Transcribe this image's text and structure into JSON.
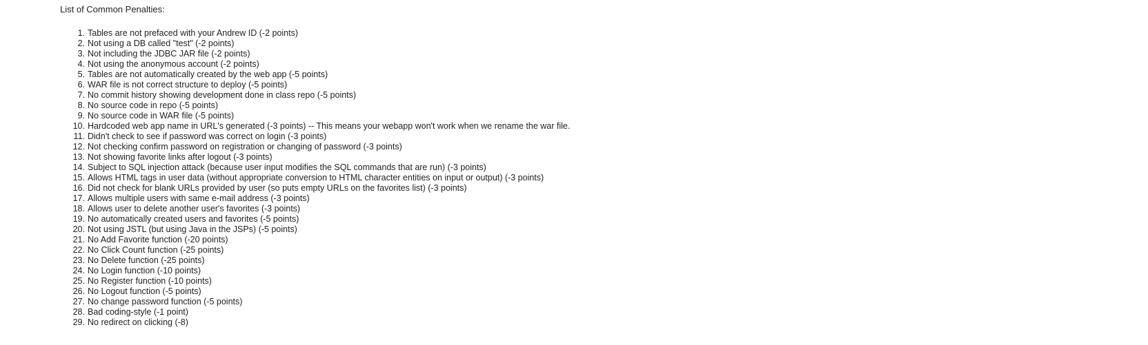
{
  "heading": "List of Common Penalties:",
  "items": [
    {
      "num": "1.",
      "text": "Tables are not prefaced with your Andrew ID (-2 points)"
    },
    {
      "num": "2.",
      "text": "Not using a DB called \"test\" (-2 points)"
    },
    {
      "num": "3.",
      "text": "Not including the JDBC JAR file (-2 points)"
    },
    {
      "num": "4.",
      "text": "Not using the anonymous account (-2 points)"
    },
    {
      "num": "5.",
      "text": "Tables are not automatically created by the web app (-5 points)"
    },
    {
      "num": "6.",
      "text": "WAR file is not correct structure to deploy (-5 points)"
    },
    {
      "num": "7.",
      "text": "No commit history showing development done in class repo (-5 points)"
    },
    {
      "num": "8.",
      "text": "No source code in repo (-5 points)"
    },
    {
      "num": "9.",
      "text": "No source code in WAR file (-5 points)"
    },
    {
      "num": "10.",
      "text": "Hardcoded web app name in URL's generated (-3 points) -- This means your webapp won't work when we rename the war file."
    },
    {
      "num": "11.",
      "text": "Didn't check to see if password was correct on login (-3 points)"
    },
    {
      "num": "12.",
      "text": "Not checking confirm password on registration or changing of password (-3 points)"
    },
    {
      "num": "13.",
      "text": "Not showing favorite links after logout (-3 points)"
    },
    {
      "num": "14.",
      "text": "Subject to SQL injection attack (because user input modifies the SQL commands that are run) (-3 points)"
    },
    {
      "num": "15.",
      "text": "Allows HTML tags in user data (without appropriate conversion to HTML character entities on input or output) (-3 points)"
    },
    {
      "num": "16.",
      "text": "Did not check for blank URLs provided by user (so puts empty URLs on the favorites list) (-3 points)"
    },
    {
      "num": "17.",
      "text": "Allows multiple users with same e-mail address (-3 points)"
    },
    {
      "num": "18.",
      "text": "Allows user to delete another user's favorites (-3 points)"
    },
    {
      "num": "19.",
      "text": "No automatically created users and favorites (-5 points)"
    },
    {
      "num": "20.",
      "text": "Not using JSTL (but using Java in the JSPs) (-5 points)"
    },
    {
      "num": "21.",
      "text": "No Add Favorite function (-20 points)"
    },
    {
      "num": "22.",
      "text": "No Click Count function (-25 points)"
    },
    {
      "num": "23.",
      "text": "No Delete function (-25 points)"
    },
    {
      "num": "24.",
      "text": "No Login function (-10 points)"
    },
    {
      "num": "25.",
      "text": "No Register function (-10 points)"
    },
    {
      "num": "26.",
      "text": "No Logout function (-5 points)"
    },
    {
      "num": "27.",
      "text": "No change password function (-5 points)"
    },
    {
      "num": "28.",
      "text": "Bad coding-style (-1 point)"
    },
    {
      "num": "29.",
      "text": "No redirect on clicking (-8)"
    }
  ]
}
